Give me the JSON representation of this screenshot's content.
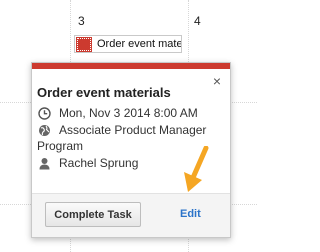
{
  "calendar": {
    "days": [
      "3",
      "4"
    ],
    "event": {
      "label": "Order event mater",
      "color": "#cc3a2f"
    }
  },
  "popup": {
    "accent_color": "#cc3a2f",
    "close_glyph": "×",
    "title": "Order event materials",
    "datetime": "Mon, Nov 3 2014 8:00 AM",
    "calendar_name": "Associate Product Manager Program",
    "calendar_name_line1": "Associate Product Manager",
    "calendar_name_line2": "Program",
    "assignee": "Rachel Sprung",
    "icons": {
      "datetime": "clock-icon",
      "calendar": "globe-icon",
      "assignee": "person-icon"
    },
    "buttons": {
      "complete": "Complete Task",
      "edit": "Edit"
    }
  },
  "annotation": {
    "arrow_color": "#f5a623"
  }
}
